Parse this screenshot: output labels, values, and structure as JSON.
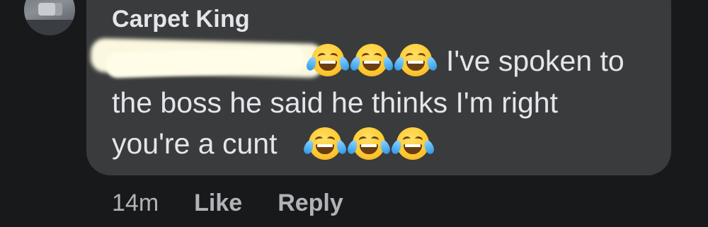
{
  "comment": {
    "author": "Carpet King",
    "text_line1": "I've spoken to",
    "text_line2": "the boss he said he thinks I'm right",
    "text_line3": "you're a cunt",
    "emoji": "face-with-tears-of-joy-icon"
  },
  "actions": {
    "time": "14m",
    "like_label": "Like",
    "reply_label": "Reply"
  },
  "colors": {
    "background": "#18191a",
    "bubble": "#3a3b3c",
    "text": "#e4e6eb",
    "secondary_text": "#b0b3b8"
  }
}
